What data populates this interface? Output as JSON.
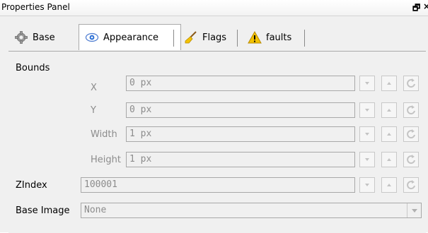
{
  "panel": {
    "title": "Properties Panel",
    "float_glyph": "🗗",
    "close_glyph": "×"
  },
  "tabs": [
    {
      "label": "Base",
      "icon": "gear-icon"
    },
    {
      "label": "Appearance",
      "icon": "eye-icon"
    },
    {
      "label": "Flags",
      "icon": "broom-icon"
    },
    {
      "label": "faults",
      "icon": "warning-icon"
    }
  ],
  "bounds": {
    "label": "Bounds",
    "x": {
      "label": "X",
      "value": "0 px"
    },
    "y": {
      "label": "Y",
      "value": "0 px"
    },
    "width": {
      "label": "Width",
      "value": "1 px"
    },
    "height": {
      "label": "Height",
      "value": "1 px"
    }
  },
  "zindex": {
    "label": "ZIndex",
    "value": "100001"
  },
  "base_image": {
    "label": "Base Image",
    "value": "None"
  },
  "colors": {
    "accent_yellow": "#f2c200",
    "eye_blue": "#2a6fd6",
    "disabled_text": "#8c8c8c"
  }
}
